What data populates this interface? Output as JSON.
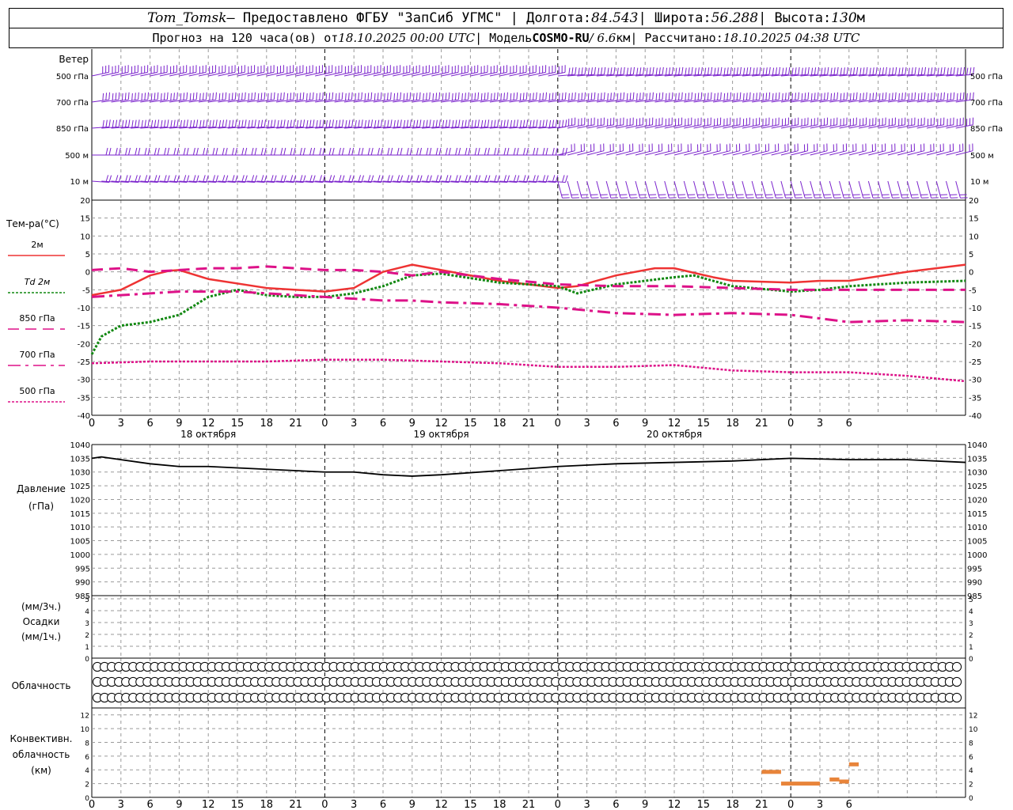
{
  "header": {
    "station": "Tom_Tomsk",
    "provided": " – Предоставлено ФГБУ \"ЗапСиб УГМС\" | Долгота: ",
    "lon": "84.543",
    "lat_label": " | Широта: ",
    "lat": "56.288",
    "alt_label": " | Высота: ",
    "alt": "130",
    "alt_unit": "м",
    "fc_label": "Прогноз на 120 часа(ов) от ",
    "fc_time": "18.10.2025 00:00 UTC",
    "model_label": " | Модель ",
    "model": "COSMO-RU",
    "res": " / 6.6",
    "res_unit": "км",
    "calc_label": " | Рассчитано: ",
    "calc_time": "18.10.2025 04:38 UTC"
  },
  "labels": {
    "wind": "Ветер",
    "levels": [
      "500 гПа",
      "700 гПа",
      "850 гПа",
      "500 м",
      "10 м"
    ],
    "temp": "Тем-ра(°С)",
    "legend": [
      "2м",
      "Td  2м",
      "850 гПа",
      "700 гПа",
      "500 гПа"
    ],
    "pressure": [
      "Давление",
      "(гПа)"
    ],
    "precip": [
      "(мм/3ч.)",
      "Осадки",
      "(мм/1ч.)"
    ],
    "cloud": "Облачность",
    "conv": [
      "Конвективн.",
      "облачность",
      "(км)"
    ],
    "days": [
      "18 октября",
      "19 октября",
      "20 октября"
    ],
    "hour_ticks": [
      "0",
      "3",
      "6",
      "9",
      "12",
      "15",
      "18",
      "21",
      "0",
      "3",
      "6",
      "9",
      "12",
      "15",
      "18",
      "21",
      "0",
      "3",
      "6",
      "9",
      "12",
      "15",
      "18",
      "21",
      "0",
      "3",
      "6"
    ]
  },
  "colors": {
    "t2m": "#ee3333",
    "td2m": "#118811",
    "t850": "#dd1188",
    "t700": "#dd1188",
    "t500": "#dd1188",
    "wind": "#7a22cc",
    "conv": "#e8843a",
    "grid": "#9a9a9a"
  },
  "chart_data": [
    {
      "type": "line",
      "title": "Тем-ра(°С)",
      "x_unit": "hours from 18.10.2025 00:00 UTC",
      "ylim": [
        -40,
        20
      ],
      "yticks": [
        -40,
        -35,
        -30,
        -25,
        -20,
        -15,
        -10,
        -5,
        0,
        5,
        10,
        15,
        20
      ],
      "series": [
        {
          "name": "2м",
          "style": "solid",
          "x": [
            0,
            3,
            6,
            8,
            9,
            12,
            18,
            21,
            24,
            27,
            30,
            33,
            36,
            42,
            48,
            50,
            54,
            58,
            60,
            64,
            66,
            72,
            75,
            78,
            84,
            90
          ],
          "y": [
            -6.5,
            -5,
            -1,
            0.3,
            0.5,
            -2,
            -4.5,
            -5,
            -5.5,
            -4.5,
            0,
            2,
            0.5,
            -2.5,
            -4.5,
            -4,
            -1,
            1,
            1,
            -1.5,
            -2.5,
            -3,
            -2.5,
            -2.5,
            0,
            2
          ]
        },
        {
          "name": "Td  2м",
          "style": "dot",
          "x": [
            0,
            1,
            3,
            6,
            9,
            12,
            15,
            18,
            21,
            24,
            27,
            30,
            33,
            36,
            42,
            48,
            50,
            54,
            60,
            62,
            66,
            72,
            75,
            78,
            84,
            90
          ],
          "y": [
            -23,
            -18,
            -15,
            -14,
            -12,
            -7,
            -5,
            -6.5,
            -7,
            -7,
            -6,
            -4,
            -1,
            -0.5,
            -3,
            -4,
            -6,
            -3.5,
            -1.5,
            -1,
            -4,
            -5.5,
            -5,
            -4,
            -3,
            -2.5
          ]
        },
        {
          "name": "850 гПа",
          "style": "dash",
          "x": [
            0,
            3,
            6,
            9,
            12,
            15,
            18,
            21,
            24,
            27,
            30,
            33,
            36,
            42,
            48,
            54,
            60,
            66,
            72,
            78,
            84,
            90
          ],
          "y": [
            0.5,
            1,
            0,
            0.5,
            1,
            1,
            1.5,
            1,
            0.5,
            0.5,
            0,
            -1,
            0,
            -2,
            -3.5,
            -4,
            -4,
            -4.5,
            -5,
            -5,
            -5,
            -5
          ]
        },
        {
          "name": "700 гПа",
          "style": "dashdot",
          "x": [
            0,
            3,
            6,
            9,
            12,
            15,
            18,
            21,
            24,
            27,
            30,
            33,
            36,
            42,
            48,
            54,
            60,
            66,
            72,
            78,
            84,
            90
          ],
          "y": [
            -7,
            -6.5,
            -6,
            -5.5,
            -5.5,
            -5.5,
            -6,
            -6.5,
            -7,
            -7.5,
            -8,
            -8,
            -8.5,
            -9,
            -10,
            -11.5,
            -12,
            -11.5,
            -12,
            -14,
            -13.5,
            -14
          ]
        },
        {
          "name": "500 гПа",
          "style": "dot",
          "x": [
            0,
            6,
            12,
            18,
            24,
            30,
            36,
            42,
            48,
            54,
            60,
            66,
            72,
            78,
            84,
            90
          ],
          "y": [
            -25.5,
            -25,
            -25,
            -25,
            -24.5,
            -24.5,
            -25,
            -25.5,
            -26.5,
            -26.5,
            -26,
            -27.5,
            -28,
            -28,
            -29,
            -30.5
          ]
        }
      ]
    },
    {
      "type": "line",
      "title": "Давление (гПа)",
      "ylim": [
        985,
        1040
      ],
      "yticks": [
        985,
        990,
        995,
        1000,
        1005,
        1010,
        1015,
        1020,
        1025,
        1030,
        1035,
        1040
      ],
      "series": [
        {
          "name": "",
          "x": [
            0,
            1,
            3,
            6,
            9,
            12,
            18,
            24,
            27,
            30,
            33,
            36,
            42,
            48,
            54,
            60,
            66,
            72,
            78,
            84,
            90
          ],
          "y": [
            1035,
            1035.5,
            1034.5,
            1033,
            1032,
            1032,
            1031,
            1030,
            1030,
            1029,
            1028.5,
            1029,
            1030.5,
            1032,
            1033,
            1033.5,
            1034,
            1035,
            1034.5,
            1034.5,
            1033.5
          ]
        }
      ]
    },
    {
      "type": "bar",
      "title": "Осадки",
      "ylim": [
        0,
        5
      ],
      "yticks": [
        0,
        1,
        2,
        3,
        4,
        5
      ],
      "values": []
    },
    {
      "type": "bar",
      "title": "Конвективн. облачность (км)",
      "ylim": [
        0,
        13
      ],
      "yticks": [
        0,
        2,
        4,
        6,
        8,
        10,
        12
      ],
      "segments": [
        {
          "x0": 69,
          "x1": 71,
          "y": 3.7
        },
        {
          "x0": 71,
          "x1": 75,
          "y": 2.0
        },
        {
          "x0": 76,
          "x1": 77,
          "y": 2.6
        },
        {
          "x0": 77,
          "x1": 78,
          "y": 2.3
        },
        {
          "x0": 78,
          "x1": 79,
          "y": 4.8
        }
      ]
    },
    {
      "type": "table",
      "title": "Облачность",
      "rows_cover_eighths": [
        [
          0,
          0,
          0,
          0,
          0,
          0,
          0,
          0,
          0,
          0,
          0,
          0,
          0,
          0,
          0,
          0,
          0,
          0,
          0,
          0,
          0,
          0,
          0,
          0,
          0,
          0,
          0,
          0,
          0,
          0,
          0,
          0,
          0,
          0,
          0,
          0,
          0,
          0,
          0,
          0,
          0,
          0,
          0,
          0,
          0,
          0,
          0,
          0,
          0,
          0,
          0,
          0,
          0,
          0,
          0,
          0,
          0,
          0,
          0,
          0,
          0,
          0,
          0,
          0,
          0,
          0,
          0,
          0,
          0,
          0,
          0,
          0,
          0,
          0,
          0,
          0,
          0,
          0,
          0,
          0,
          0,
          0,
          0,
          0,
          0,
          0,
          0,
          0,
          0,
          0,
          0,
          0,
          0,
          0,
          0,
          0,
          0,
          0,
          0,
          0,
          0,
          0,
          0,
          0,
          0,
          0,
          0,
          0,
          0,
          0,
          0,
          0,
          0,
          0,
          0,
          0,
          0,
          0,
          0,
          0,
          0
        ],
        [
          0,
          0,
          0,
          0,
          0,
          0,
          0,
          0,
          0,
          0,
          0,
          0,
          0,
          0,
          0,
          0,
          0,
          0,
          0,
          0,
          0,
          0,
          0,
          0,
          0,
          0,
          0,
          0,
          0,
          0,
          0,
          0,
          0,
          0,
          0,
          0,
          0,
          0,
          0,
          0,
          0,
          0,
          0,
          0,
          0,
          0,
          0,
          0,
          0,
          0,
          0,
          0,
          0,
          0,
          0,
          0,
          0,
          0,
          0,
          0,
          0,
          0,
          0,
          0,
          0,
          0,
          0,
          0,
          0,
          0,
          0,
          0,
          0,
          0,
          0,
          0,
          0,
          0,
          0,
          0,
          0,
          0,
          0,
          0,
          0,
          0,
          0,
          0,
          0,
          0,
          0,
          0,
          0,
          0,
          0,
          0,
          0,
          0,
          0,
          0,
          0,
          0,
          0,
          0,
          0,
          0,
          0,
          0,
          0,
          0,
          0,
          0,
          0,
          0,
          0,
          0,
          0,
          0,
          0,
          0,
          0
        ],
        [
          0,
          0,
          0,
          0,
          0,
          0,
          0,
          0,
          0,
          0,
          0,
          0,
          0,
          0,
          0,
          0,
          0,
          0,
          0,
          0,
          0,
          0,
          0,
          0,
          0,
          0,
          0,
          0,
          0,
          0,
          0,
          0,
          0,
          0,
          0,
          0,
          0,
          0,
          0,
          0,
          0,
          0,
          0,
          0,
          0,
          0,
          0,
          0,
          0,
          0,
          0,
          0,
          0,
          0,
          0,
          0,
          0,
          0,
          0,
          0,
          0,
          0,
          0,
          0,
          0,
          0,
          0,
          0,
          0,
          0,
          0,
          0,
          0,
          0,
          0,
          0,
          0,
          0,
          0,
          0,
          0,
          0,
          0,
          0,
          0,
          0,
          0,
          0,
          0,
          0,
          0,
          0,
          0,
          0,
          0,
          0,
          0,
          0,
          0,
          0,
          0,
          0,
          0,
          0,
          0,
          0,
          0,
          0,
          0,
          0,
          0,
          0,
          0,
          0,
          0,
          0,
          0,
          0,
          0,
          0,
          0
        ]
      ]
    }
  ]
}
